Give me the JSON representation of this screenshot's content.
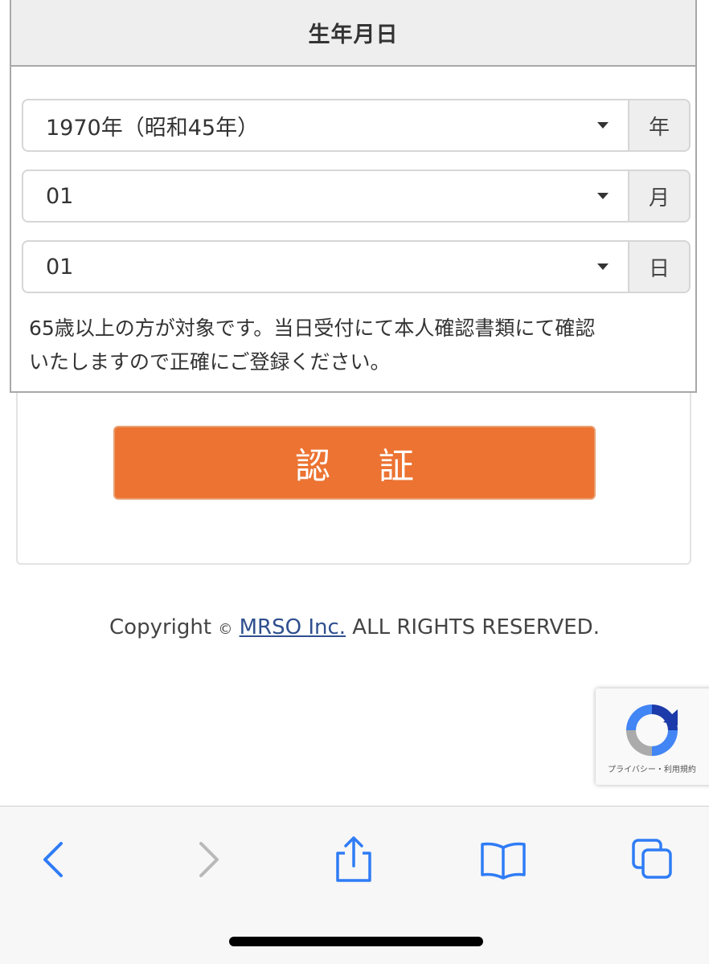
{
  "dob": {
    "header": "生年月日",
    "year": {
      "value": "1970年（昭和45年）",
      "unit": "年"
    },
    "month": {
      "value": "01",
      "unit": "月"
    },
    "day": {
      "value": "01",
      "unit": "日"
    },
    "note_line1": "65歳以上の方が対象です。当日受付にて本人確認書類にて確認",
    "note_line2": "いたしますので正確にご登録ください。"
  },
  "auth_button_label": "認証",
  "footer": {
    "copyright_prefix": "Copyright",
    "copyright_symbol": "©",
    "company_link": "MRSO Inc.",
    "rights": "ALL RIGHTS RESERVED."
  },
  "recaptcha": {
    "terms": "プライバシー・利用規約"
  },
  "browser_toolbar": {
    "icons": [
      "back-icon",
      "forward-icon",
      "share-icon",
      "bookmarks-icon",
      "tabs-icon"
    ]
  },
  "colors": {
    "accent": "#ec7332",
    "ios_blue": "#2f7cf6",
    "link": "#2f4f8f"
  }
}
